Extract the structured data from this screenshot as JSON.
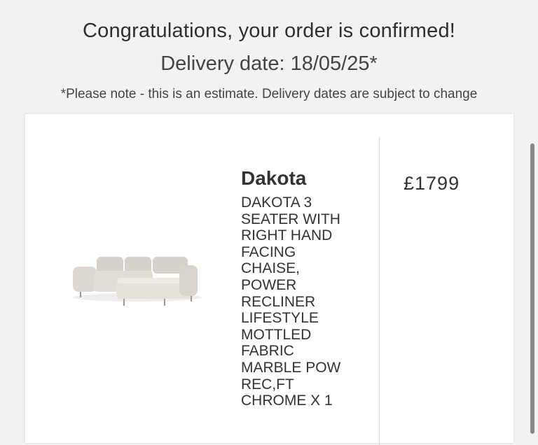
{
  "header": {
    "title": "Congratulations, your order is confirmed!",
    "delivery": "Delivery date: 18/05/25*",
    "note": "*Please note - this is an estimate. Delivery dates are subject to change"
  },
  "order_item": {
    "name": "Dakota",
    "description": "DAKOTA 3 SEATER WITH RIGHT HAND FACING CHAISE, POWER RECLINER LIFESTYLE MOTTLED FABRIC MARBLE POW REC,FT CHROME X 1",
    "price": "£1799"
  },
  "colors": {
    "background": "#f2f2f2",
    "card": "#ffffff",
    "text": "#333333",
    "sofa": "#d9d5cc"
  }
}
